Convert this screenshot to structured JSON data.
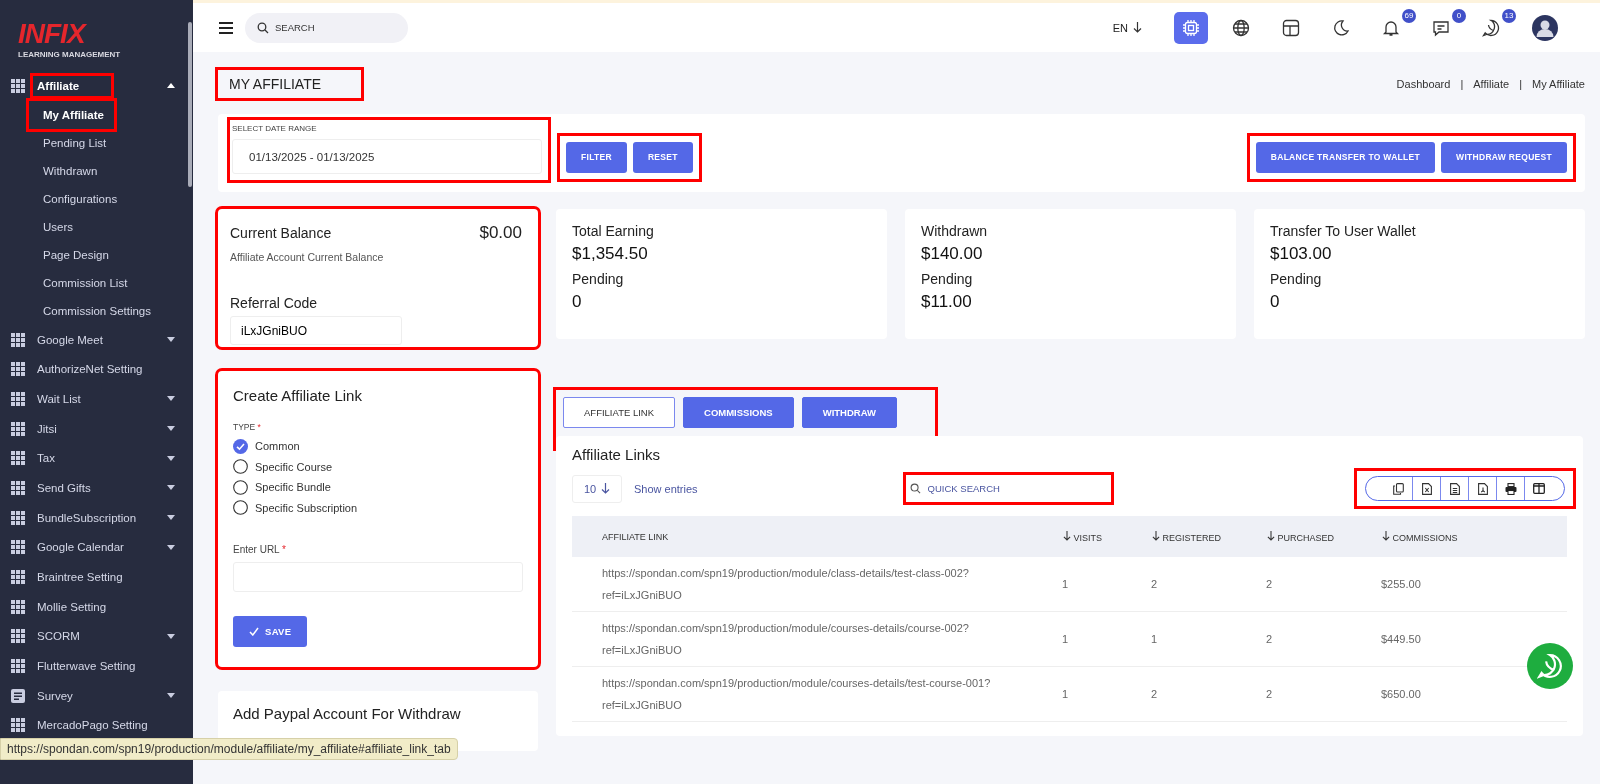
{
  "sidebar": {
    "logo": {
      "brand": "INFIX",
      "tagline": "LEARNING MANAGEMENT"
    },
    "items": [
      {
        "label": "Affiliate",
        "kind": "grid",
        "expandable": true,
        "expanded": true,
        "highlighted": true,
        "children": [
          {
            "label": "My Affiliate",
            "selected": true,
            "highlighted": true
          },
          {
            "label": "Pending List",
            "selected": false,
            "highlighted": false
          },
          {
            "label": "Withdrawn",
            "selected": false,
            "highlighted": false
          },
          {
            "label": "Configurations",
            "selected": false,
            "highlighted": false
          },
          {
            "label": "Users",
            "selected": false,
            "highlighted": false
          },
          {
            "label": "Page Design",
            "selected": false,
            "highlighted": false
          },
          {
            "label": "Commission List",
            "selected": false,
            "highlighted": false
          },
          {
            "label": "Commission Settings",
            "selected": false,
            "highlighted": false
          }
        ]
      },
      {
        "label": "Google Meet",
        "kind": "grid",
        "expandable": true,
        "expanded": false,
        "highlighted": false
      },
      {
        "label": "AuthorizeNet Setting",
        "kind": "grid",
        "expandable": false,
        "expanded": false,
        "highlighted": false
      },
      {
        "label": "Wait List",
        "kind": "grid",
        "expandable": true,
        "expanded": false,
        "highlighted": false
      },
      {
        "label": "Jitsi",
        "kind": "grid",
        "expandable": true,
        "expanded": false,
        "highlighted": false
      },
      {
        "label": "Tax",
        "kind": "grid",
        "expandable": true,
        "expanded": false,
        "highlighted": false
      },
      {
        "label": "Send Gifts",
        "kind": "grid",
        "expandable": true,
        "expanded": false,
        "highlighted": false
      },
      {
        "label": "BundleSubscription",
        "kind": "grid",
        "expandable": true,
        "expanded": false,
        "highlighted": false
      },
      {
        "label": "Google Calendar",
        "kind": "grid",
        "expandable": true,
        "expanded": false,
        "highlighted": false
      },
      {
        "label": "Braintree Setting",
        "kind": "grid",
        "expandable": false,
        "expanded": false,
        "highlighted": false
      },
      {
        "label": "Mollie Setting",
        "kind": "grid",
        "expandable": false,
        "expanded": false,
        "highlighted": false
      },
      {
        "label": "SCORM",
        "kind": "grid",
        "expandable": true,
        "expanded": false,
        "highlighted": false
      },
      {
        "label": "Flutterwave Setting",
        "kind": "grid",
        "expandable": false,
        "expanded": false,
        "highlighted": false
      },
      {
        "label": "Survey",
        "kind": "document",
        "expandable": true,
        "expanded": false,
        "highlighted": false
      },
      {
        "label": "MercadoPago Setting",
        "kind": "grid",
        "expandable": false,
        "expanded": false,
        "highlighted": false
      }
    ]
  },
  "topbar": {
    "search": {
      "placeholder": "SEARCH"
    },
    "language": "EN",
    "icons": [
      {
        "kind": "chip",
        "selected": true
      },
      {
        "kind": "globe",
        "selected": false
      },
      {
        "kind": "layout",
        "selected": false
      },
      {
        "kind": "moon",
        "selected": false
      },
      {
        "kind": "bell",
        "selected": false,
        "badge": "69"
      },
      {
        "kind": "chat",
        "selected": false,
        "badge": "0"
      },
      {
        "kind": "phone",
        "selected": false,
        "badge": "13"
      }
    ]
  },
  "page": {
    "title": "MY AFFILIATE",
    "title_highlighted": true,
    "breadcrumb": [
      "Dashboard",
      "Affiliate",
      "My Affiliate"
    ],
    "breadcrumb_separator": "|"
  },
  "filter": {
    "label": "SELECT DATE RANGE",
    "value": "01/13/2025 - 01/13/2025",
    "field_highlighted": true,
    "buttons": [
      "FILTER",
      "RESET"
    ],
    "buttons_highlighted": true,
    "actions": [
      "BALANCE TRANSFER TO WALLET",
      "WITHDRAW REQUEST"
    ],
    "actions_highlighted": true
  },
  "balance": {
    "title": "Current Balance",
    "amount": "$0.00",
    "subtitle": "Affiliate Account Current Balance",
    "referral_label": "Referral Code",
    "referral_code": "iLxJGniBUO",
    "highlighted": true
  },
  "stats": [
    {
      "title": "Total Earning",
      "value": "$1,354.50",
      "pending_label": "Pending",
      "pending": "0"
    },
    {
      "title": "Withdrawn",
      "value": "$140.00",
      "pending_label": "Pending",
      "pending": "$11.00"
    },
    {
      "title": "Transfer To User Wallet",
      "value": "$103.00",
      "pending_label": "Pending",
      "pending": "0"
    }
  ],
  "create_link": {
    "title": "Create Affiliate Link",
    "type_label": "TYPE",
    "required_mark": "*",
    "highlighted": true,
    "options": [
      {
        "label": "Common",
        "selected": true
      },
      {
        "label": "Specific Course",
        "selected": false
      },
      {
        "label": "Specific Bundle",
        "selected": false
      },
      {
        "label": "Specific Subscription",
        "selected": false
      }
    ],
    "url_label": "Enter URL",
    "save": "SAVE"
  },
  "paypal_card": {
    "title": "Add Paypal Account For Withdraw"
  },
  "tabs": {
    "highlighted": true,
    "items": [
      {
        "label": "AFFILIATE LINK",
        "selected": true
      },
      {
        "label": "COMMISSIONS",
        "selected": false
      },
      {
        "label": "WITHDRAW",
        "selected": false
      }
    ]
  },
  "table": {
    "title": "Affiliate Links",
    "page_size": "10",
    "show_entries": "Show entries",
    "search": {
      "placeholder": "QUICK SEARCH",
      "highlighted": true
    },
    "export_highlighted": true,
    "export_buttons": [
      {
        "kind": "copy"
      },
      {
        "kind": "excel"
      },
      {
        "kind": "csv"
      },
      {
        "kind": "pdf"
      },
      {
        "kind": "print"
      },
      {
        "kind": "columns"
      }
    ],
    "columns": [
      {
        "label": "AFFILIATE LINK",
        "sortable": false
      },
      {
        "label": "VISITS",
        "sortable": true
      },
      {
        "label": "REGISTERED",
        "sortable": true
      },
      {
        "label": "PURCHASED",
        "sortable": true
      },
      {
        "label": "COMMISSIONS",
        "sortable": true
      }
    ],
    "rows": [
      [
        "https://spondan.com/spn19/production/module/class-details/test-class-002?ref=iLxJGniBUO",
        "1",
        "2",
        "2",
        "$255.00"
      ],
      [
        "https://spondan.com/spn19/production/module/courses-details/course-002?ref=iLxJGniBUO",
        "1",
        "1",
        "2",
        "$449.50"
      ],
      [
        "https://spondan.com/spn19/production/module/courses-details/test-course-001?ref=iLxJGniBUO",
        "1",
        "2",
        "2",
        "$650.00"
      ]
    ]
  },
  "status_url": "https://spondan.com/spn19/production/module/affiliate/my_affiliate#affiliate_link_tab"
}
